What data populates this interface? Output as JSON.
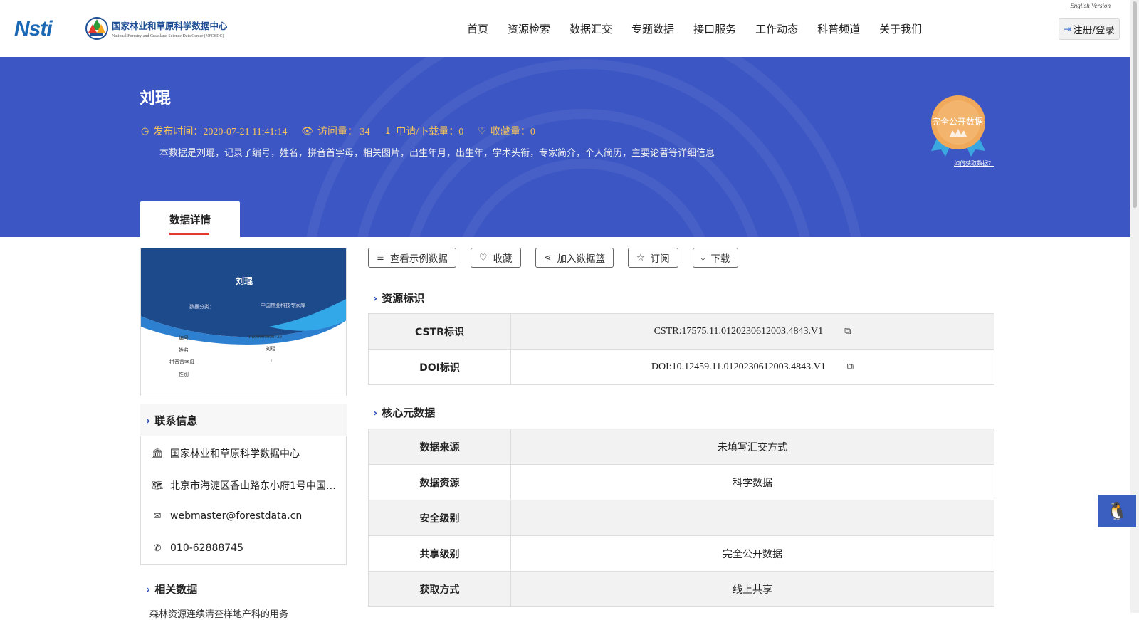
{
  "header": {
    "logo_nsti": "Nsti",
    "center_name_cn": "国家林业和草原科学数据中心",
    "center_name_en": "National Forestry and Grassland Science Data Center (NFGSDC)",
    "english_link": "English Version",
    "nav": [
      "首页",
      "资源检索",
      "数据汇交",
      "专题数据",
      "接口服务",
      "工作动态",
      "科普频道",
      "关于我们"
    ],
    "login_label": "注册/登录"
  },
  "banner": {
    "title": "刘琨",
    "publish_time": "发布时间：2020-07-21 11:41:14",
    "views": "访问量： 34",
    "downloads": "申请/下载量：0",
    "favorites": "收藏量：0",
    "description": "本数据是刘琨，记录了编号，姓名，拼音首字母，相关图片，出生年月，出生年，学术头衔，专家简介，个人简历，主要论著等详细信息",
    "badge_text": "完全公开数据",
    "howto_link": "如何获取数据？",
    "tab_label": "数据详情"
  },
  "thumbnail": {
    "name": "刘琨",
    "category_label": "数据分类：",
    "category_value": "中国林业科技专家库",
    "fields": [
      {
        "k": "编号",
        "v": "mrzj0000000739"
      },
      {
        "k": "姓名",
        "v": "刘琨"
      },
      {
        "k": "拼音首字母",
        "v": "l"
      },
      {
        "k": "性别",
        "v": ""
      }
    ]
  },
  "contact": {
    "title": "联系信息",
    "org": "国家林业和草原科学数据中心",
    "address": "北京市海淀区香山路东小府1号中国…",
    "email": "webmaster@forestdata.cn",
    "phone": "010-62888745"
  },
  "related": {
    "title": "相关数据",
    "first_item": "森林资源连续清查样地产科的用务"
  },
  "actions": {
    "sample": "查看示例数据",
    "favorite": "收藏",
    "basket": "加入数据篮",
    "subscribe": "订阅",
    "download": "下载"
  },
  "resource_id": {
    "title": "资源标识",
    "rows": [
      {
        "k": "CSTR标识",
        "v": "CSTR:17575.11.0120230612003.4843.V1"
      },
      {
        "k": "DOI标识",
        "v": "DOI:10.12459.11.0120230612003.4843.V1"
      }
    ]
  },
  "core_meta": {
    "title": "核心元数据",
    "rows": [
      {
        "k": "数据来源",
        "v": "未填写汇交方式"
      },
      {
        "k": "数据资源",
        "v": "科学数据"
      },
      {
        "k": "安全级别",
        "v": ""
      },
      {
        "k": "共享级别",
        "v": "完全公开数据"
      },
      {
        "k": "获取方式",
        "v": "线上共享"
      }
    ]
  },
  "icons": {
    "clock": "clock-icon",
    "eye": "eye-icon",
    "download": "download-icon",
    "heart": "heart-icon",
    "bank": "bank-icon",
    "map": "map-icon",
    "mail": "mail-icon",
    "phone": "phone-icon",
    "database": "database-icon",
    "share": "share-icon",
    "star": "star-icon",
    "copy": "copy-icon",
    "qq": "qq-icon"
  },
  "colors": {
    "banner": "#3c57c4",
    "meta": "#f5c25b",
    "accent": "#2a4fb8",
    "tab_underline": "#e23a2f"
  }
}
